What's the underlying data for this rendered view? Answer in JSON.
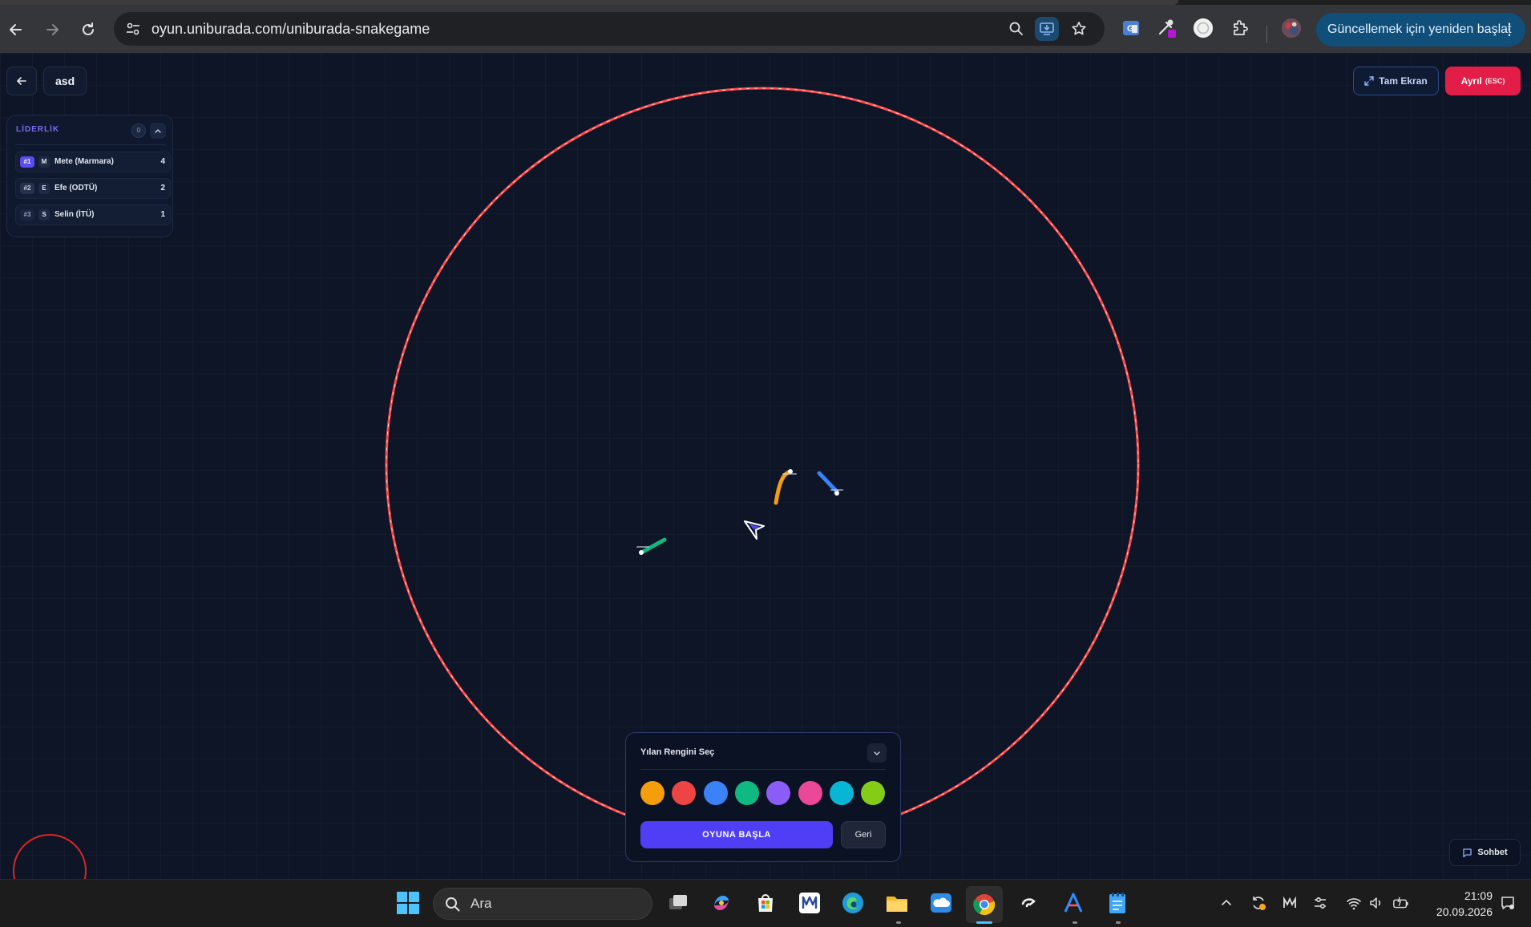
{
  "browser": {
    "url": "oyun.uniburada.com/uniburada-snakegame",
    "update_button": "Güncellemek için yeniden başlat",
    "update_menu": "⋮"
  },
  "game": {
    "room_name": "asd",
    "fullscreen_label": "Tam Ekran",
    "leave_label": "Ayrıl",
    "leave_hint": "(ESC)",
    "leaderboard": {
      "title": "LİDERLİK",
      "count": "0",
      "rows": [
        {
          "rank": "#1",
          "initial": "M",
          "name": "Mete (Marmara)",
          "score": "4"
        },
        {
          "rank": "#2",
          "initial": "E",
          "name": "Efe (ODTÜ)",
          "score": "2"
        },
        {
          "rank": "#3",
          "initial": "S",
          "name": "Selin (İTÜ)",
          "score": "1"
        }
      ]
    },
    "color_panel": {
      "title": "Yılan Rengini Seç",
      "swatches": [
        "#f59e0b",
        "#ef4444",
        "#3b82f6",
        "#10b981",
        "#8b5cf6",
        "#ec4899",
        "#06b6d4",
        "#84cc16"
      ],
      "start_label": "OYUNA BAŞLA",
      "back_label": "Geri"
    },
    "chat_label": "Sohbet",
    "arena_color": "#ff4d4d"
  },
  "taskbar": {
    "search_placeholder": "Ara",
    "time": "21:09",
    "date": "20.09.2026"
  }
}
